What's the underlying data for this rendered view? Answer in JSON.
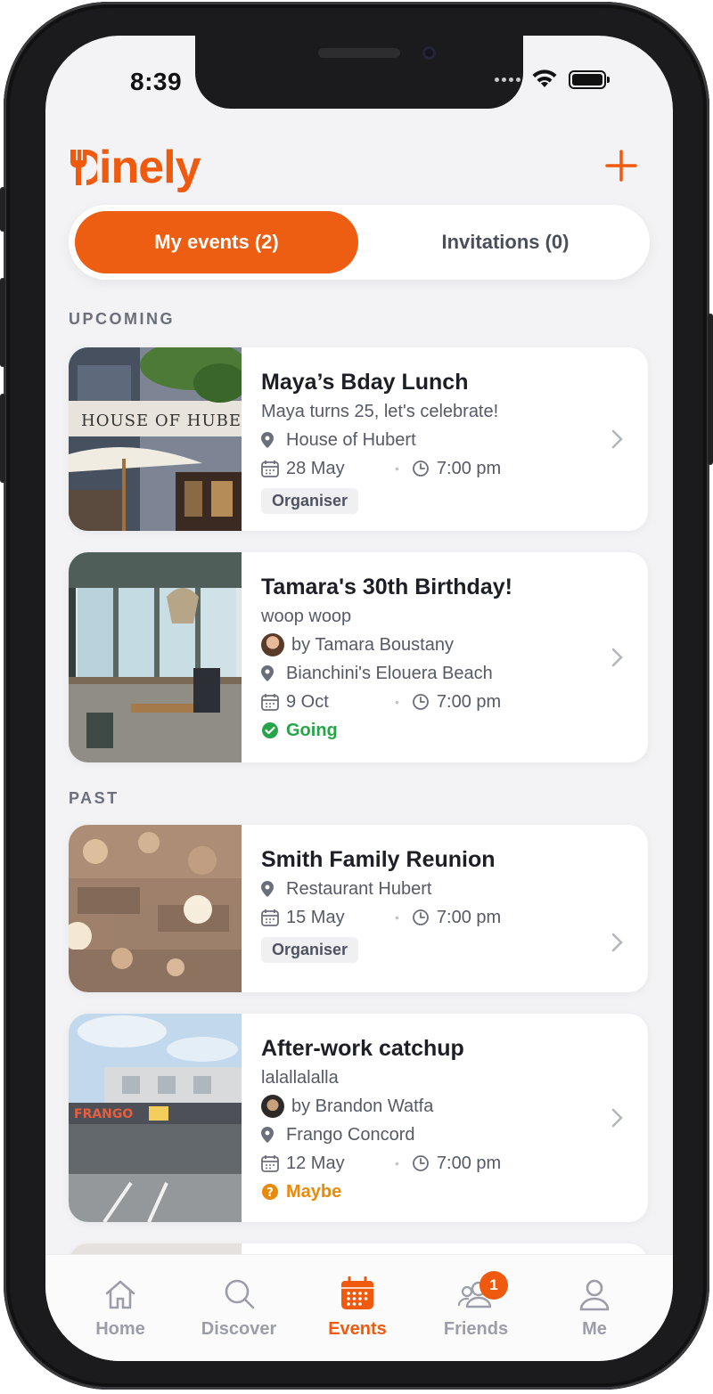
{
  "status_bar": {
    "time": "8:39"
  },
  "app": {
    "name": "Dinely",
    "logo_suffix": "inely",
    "brand_color": "#ef5a0e",
    "add_icon": "plus-icon"
  },
  "tabs": {
    "my_events": "My events (2)",
    "invitations": "Invitations (0)"
  },
  "sections": {
    "upcoming": "UPCOMING",
    "past": "PAST"
  },
  "events": [
    {
      "title": "Maya’s Bday Lunch",
      "subtitle": "Maya turns 25, let's celebrate!",
      "host": "",
      "venue": "House of Hubert",
      "date": "28 May",
      "time": "7:00 pm",
      "tag": "Organiser"
    },
    {
      "title": "Tamara's 30th Birthday!",
      "subtitle": "woop woop",
      "host": "by Tamara Boustany",
      "venue": "Bianchini's Elouera Beach",
      "date": "9 Oct",
      "time": "7:00 pm",
      "status": "Going"
    },
    {
      "title": "Smith Family Reunion",
      "venue": "Restaurant Hubert",
      "date": "15 May",
      "time": "7:00 pm",
      "tag": "Organiser"
    },
    {
      "title": "After-work catchup",
      "subtitle": "lalallalalla",
      "host": "by Brandon Watfa",
      "venue": "Frango Concord",
      "date": "12 May",
      "time": "7:00 pm",
      "status": "Maybe"
    }
  ],
  "bottom_nav": {
    "home": "Home",
    "discover": "Discover",
    "events": "Events",
    "friends": "Friends",
    "friends_badge": "1",
    "me": "Me",
    "active": "Events"
  }
}
